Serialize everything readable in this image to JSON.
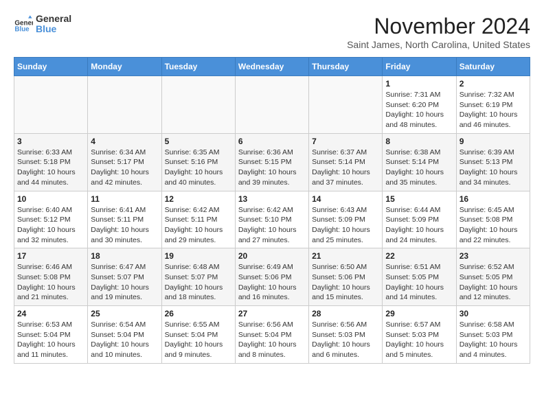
{
  "logo": {
    "general": "General",
    "blue": "Blue"
  },
  "header": {
    "month": "November 2024",
    "location": "Saint James, North Carolina, United States"
  },
  "weekdays": [
    "Sunday",
    "Monday",
    "Tuesday",
    "Wednesday",
    "Thursday",
    "Friday",
    "Saturday"
  ],
  "rows": [
    [
      {
        "day": "",
        "info": ""
      },
      {
        "day": "",
        "info": ""
      },
      {
        "day": "",
        "info": ""
      },
      {
        "day": "",
        "info": ""
      },
      {
        "day": "",
        "info": ""
      },
      {
        "day": "1",
        "info": "Sunrise: 7:31 AM\nSunset: 6:20 PM\nDaylight: 10 hours and 48 minutes."
      },
      {
        "day": "2",
        "info": "Sunrise: 7:32 AM\nSunset: 6:19 PM\nDaylight: 10 hours and 46 minutes."
      }
    ],
    [
      {
        "day": "3",
        "info": "Sunrise: 6:33 AM\nSunset: 5:18 PM\nDaylight: 10 hours and 44 minutes."
      },
      {
        "day": "4",
        "info": "Sunrise: 6:34 AM\nSunset: 5:17 PM\nDaylight: 10 hours and 42 minutes."
      },
      {
        "day": "5",
        "info": "Sunrise: 6:35 AM\nSunset: 5:16 PM\nDaylight: 10 hours and 40 minutes."
      },
      {
        "day": "6",
        "info": "Sunrise: 6:36 AM\nSunset: 5:15 PM\nDaylight: 10 hours and 39 minutes."
      },
      {
        "day": "7",
        "info": "Sunrise: 6:37 AM\nSunset: 5:14 PM\nDaylight: 10 hours and 37 minutes."
      },
      {
        "day": "8",
        "info": "Sunrise: 6:38 AM\nSunset: 5:14 PM\nDaylight: 10 hours and 35 minutes."
      },
      {
        "day": "9",
        "info": "Sunrise: 6:39 AM\nSunset: 5:13 PM\nDaylight: 10 hours and 34 minutes."
      }
    ],
    [
      {
        "day": "10",
        "info": "Sunrise: 6:40 AM\nSunset: 5:12 PM\nDaylight: 10 hours and 32 minutes."
      },
      {
        "day": "11",
        "info": "Sunrise: 6:41 AM\nSunset: 5:11 PM\nDaylight: 10 hours and 30 minutes."
      },
      {
        "day": "12",
        "info": "Sunrise: 6:42 AM\nSunset: 5:11 PM\nDaylight: 10 hours and 29 minutes."
      },
      {
        "day": "13",
        "info": "Sunrise: 6:42 AM\nSunset: 5:10 PM\nDaylight: 10 hours and 27 minutes."
      },
      {
        "day": "14",
        "info": "Sunrise: 6:43 AM\nSunset: 5:09 PM\nDaylight: 10 hours and 25 minutes."
      },
      {
        "day": "15",
        "info": "Sunrise: 6:44 AM\nSunset: 5:09 PM\nDaylight: 10 hours and 24 minutes."
      },
      {
        "day": "16",
        "info": "Sunrise: 6:45 AM\nSunset: 5:08 PM\nDaylight: 10 hours and 22 minutes."
      }
    ],
    [
      {
        "day": "17",
        "info": "Sunrise: 6:46 AM\nSunset: 5:08 PM\nDaylight: 10 hours and 21 minutes."
      },
      {
        "day": "18",
        "info": "Sunrise: 6:47 AM\nSunset: 5:07 PM\nDaylight: 10 hours and 19 minutes."
      },
      {
        "day": "19",
        "info": "Sunrise: 6:48 AM\nSunset: 5:07 PM\nDaylight: 10 hours and 18 minutes."
      },
      {
        "day": "20",
        "info": "Sunrise: 6:49 AM\nSunset: 5:06 PM\nDaylight: 10 hours and 16 minutes."
      },
      {
        "day": "21",
        "info": "Sunrise: 6:50 AM\nSunset: 5:06 PM\nDaylight: 10 hours and 15 minutes."
      },
      {
        "day": "22",
        "info": "Sunrise: 6:51 AM\nSunset: 5:05 PM\nDaylight: 10 hours and 14 minutes."
      },
      {
        "day": "23",
        "info": "Sunrise: 6:52 AM\nSunset: 5:05 PM\nDaylight: 10 hours and 12 minutes."
      }
    ],
    [
      {
        "day": "24",
        "info": "Sunrise: 6:53 AM\nSunset: 5:04 PM\nDaylight: 10 hours and 11 minutes."
      },
      {
        "day": "25",
        "info": "Sunrise: 6:54 AM\nSunset: 5:04 PM\nDaylight: 10 hours and 10 minutes."
      },
      {
        "day": "26",
        "info": "Sunrise: 6:55 AM\nSunset: 5:04 PM\nDaylight: 10 hours and 9 minutes."
      },
      {
        "day": "27",
        "info": "Sunrise: 6:56 AM\nSunset: 5:04 PM\nDaylight: 10 hours and 8 minutes."
      },
      {
        "day": "28",
        "info": "Sunrise: 6:56 AM\nSunset: 5:03 PM\nDaylight: 10 hours and 6 minutes."
      },
      {
        "day": "29",
        "info": "Sunrise: 6:57 AM\nSunset: 5:03 PM\nDaylight: 10 hours and 5 minutes."
      },
      {
        "day": "30",
        "info": "Sunrise: 6:58 AM\nSunset: 5:03 PM\nDaylight: 10 hours and 4 minutes."
      }
    ]
  ]
}
